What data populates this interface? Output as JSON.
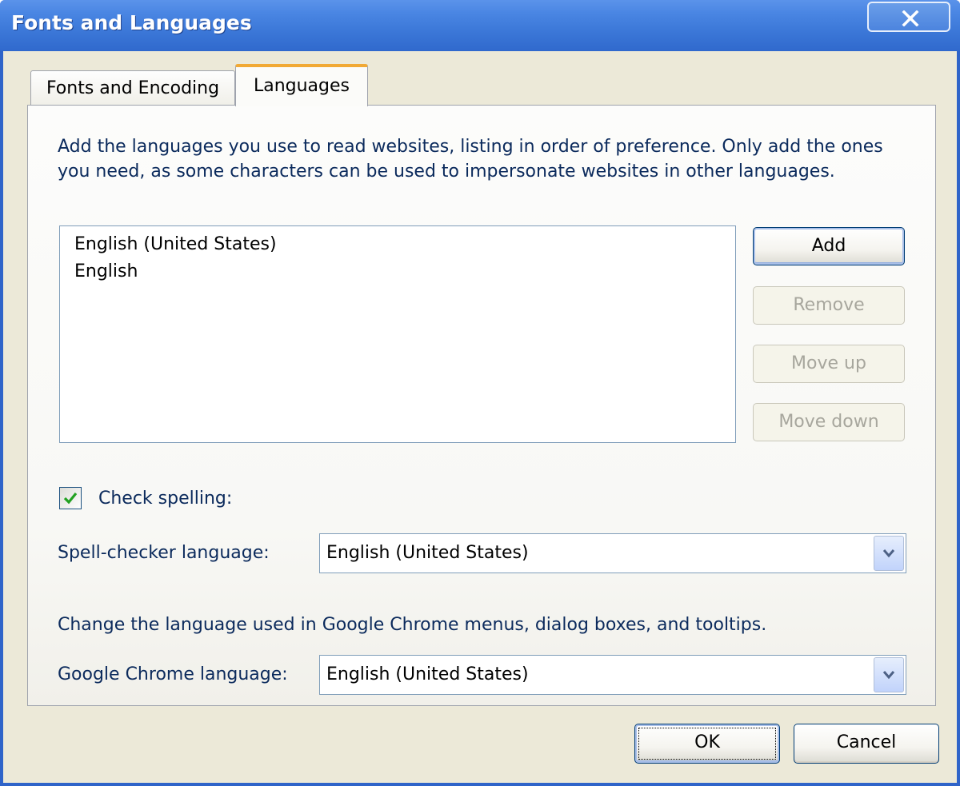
{
  "window": {
    "title": "Fonts and Languages"
  },
  "tabs": [
    {
      "label": "Fonts and Encoding",
      "selected": false
    },
    {
      "label": "Languages",
      "selected": true
    }
  ],
  "languages_tab": {
    "description": "Add the languages you use to read websites, listing in order of preference. Only add the ones you need, as some characters can be used to impersonate websites in other languages.",
    "language_list": [
      "English (United States)",
      "English"
    ],
    "buttons": {
      "add": "Add",
      "remove": "Remove",
      "move_up": "Move up",
      "move_down": "Move down"
    },
    "check_spelling": {
      "label": "Check spelling:",
      "checked": true
    },
    "spell_checker": {
      "label": "Spell-checker language:",
      "value": "English (United States)"
    },
    "ui_language": {
      "description": "Change the language used in Google Chrome menus, dialog boxes, and tooltips.",
      "label": "Google Chrome language:",
      "value": "English (United States)"
    }
  },
  "footer": {
    "ok": "OK",
    "cancel": "Cancel"
  },
  "colors": {
    "titlebar": "#3c78d8",
    "dialog_bg": "#ece9d8",
    "tab_accent": "#f1a934",
    "label_text": "#0b2a5c",
    "checkmark": "#21a121"
  },
  "icons": {
    "close": "close-x-icon",
    "checkbox": "checkmark-icon",
    "dropdown": "chevron-down-icon"
  }
}
